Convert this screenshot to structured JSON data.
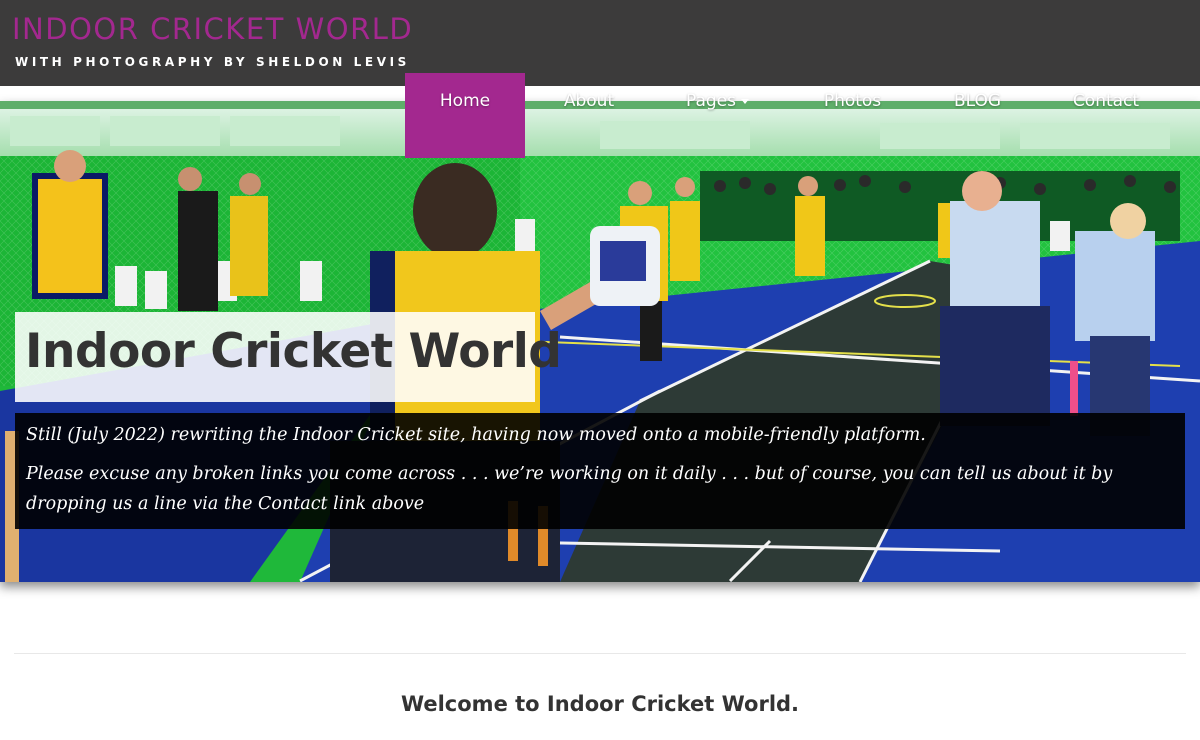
{
  "site": {
    "title": "INDOOR CRICKET WORLD",
    "tagline": "WITH PHOTOGRAPHY BY SHELDON LEVIS"
  },
  "nav": {
    "items": [
      {
        "label": "Home",
        "active": true
      },
      {
        "label": "About"
      },
      {
        "label": "Pages",
        "has_dropdown": true
      },
      {
        "label": "Photos"
      },
      {
        "label": "BLOG"
      },
      {
        "label": "Contact"
      }
    ]
  },
  "hero": {
    "title": "Indoor Cricket World",
    "notice_lines": [
      "Still (July 2022) rewriting the Indoor Cricket site, having now moved onto a mobile-friendly platform.",
      "Please excuse any broken links you come across . . . we’re working on it daily . . . but of course, you can tell us about it by dropping us a line via the Contact link above"
    ],
    "image_icon": "indoor-cricket-match-photo"
  },
  "content": {
    "welcome": "Welcome to Indoor Cricket World."
  },
  "colors": {
    "brand_magenta": "#a3288f",
    "header_bg": "#3c3b3b",
    "court_blue": "#1e3fb0",
    "net_green": "#1fc23c"
  }
}
